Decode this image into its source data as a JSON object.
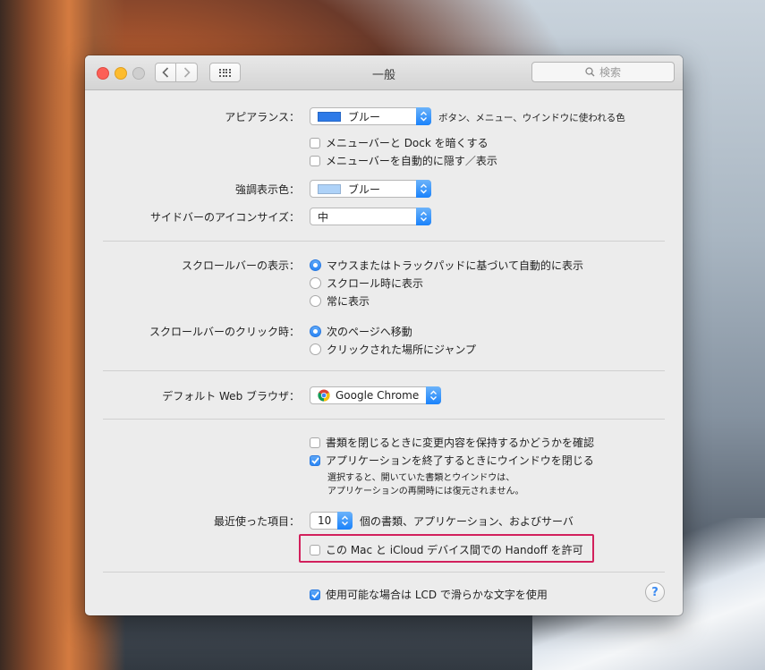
{
  "window": {
    "title": "一般",
    "search_placeholder": "検索"
  },
  "appearance": {
    "label": "アピアランス：",
    "value": "ブルー",
    "hint": "ボタン、メニュー、ウインドウに使われる色",
    "swatch_color": "#2d7ae8"
  },
  "menubar_options": {
    "dark": "メニューバーと Dock を暗くする",
    "autohide": "メニューバーを自動的に隠す／表示"
  },
  "highlight_color": {
    "label": "強調表示色：",
    "value": "ブルー",
    "swatch_color": "#aed2f8"
  },
  "sidebar_icon_size": {
    "label": "サイドバーのアイコンサイズ：",
    "value": "中"
  },
  "scrollbar_show": {
    "label": "スクロールバーの表示：",
    "options": [
      "マウスまたはトラックパッドに基づいて自動的に表示",
      "スクロール時に表示",
      "常に表示"
    ],
    "selected": 0
  },
  "scrollbar_click": {
    "label": "スクロールバーのクリック時：",
    "options": [
      "次のページへ移動",
      "クリックされた場所にジャンプ"
    ],
    "selected": 0
  },
  "default_browser": {
    "label": "デフォルト Web ブラウザ：",
    "value": "Google Chrome"
  },
  "documents": {
    "ask_keep_changes": "書類を閉じるときに変更内容を保持するかどうかを確認",
    "close_windows": "アプリケーションを終了するときにウインドウを閉じる",
    "note_line1": "選択すると、開いていた書類とウインドウは、",
    "note_line2": "アプリケーションの再開時には復元されません。"
  },
  "recent_items": {
    "label": "最近使った項目：",
    "value": "10",
    "suffix": "個の書類、アプリケーション、およびサーバ"
  },
  "handoff": {
    "label": "この Mac と iCloud デバイス間での Handoff を許可"
  },
  "lcd_smoothing": {
    "label": "使用可能な場合は LCD で滑らかな文字を使用"
  },
  "help": {
    "label": "?"
  },
  "colors": {
    "accent": "#2a86f5",
    "handoff_outline": "#d2205c"
  }
}
